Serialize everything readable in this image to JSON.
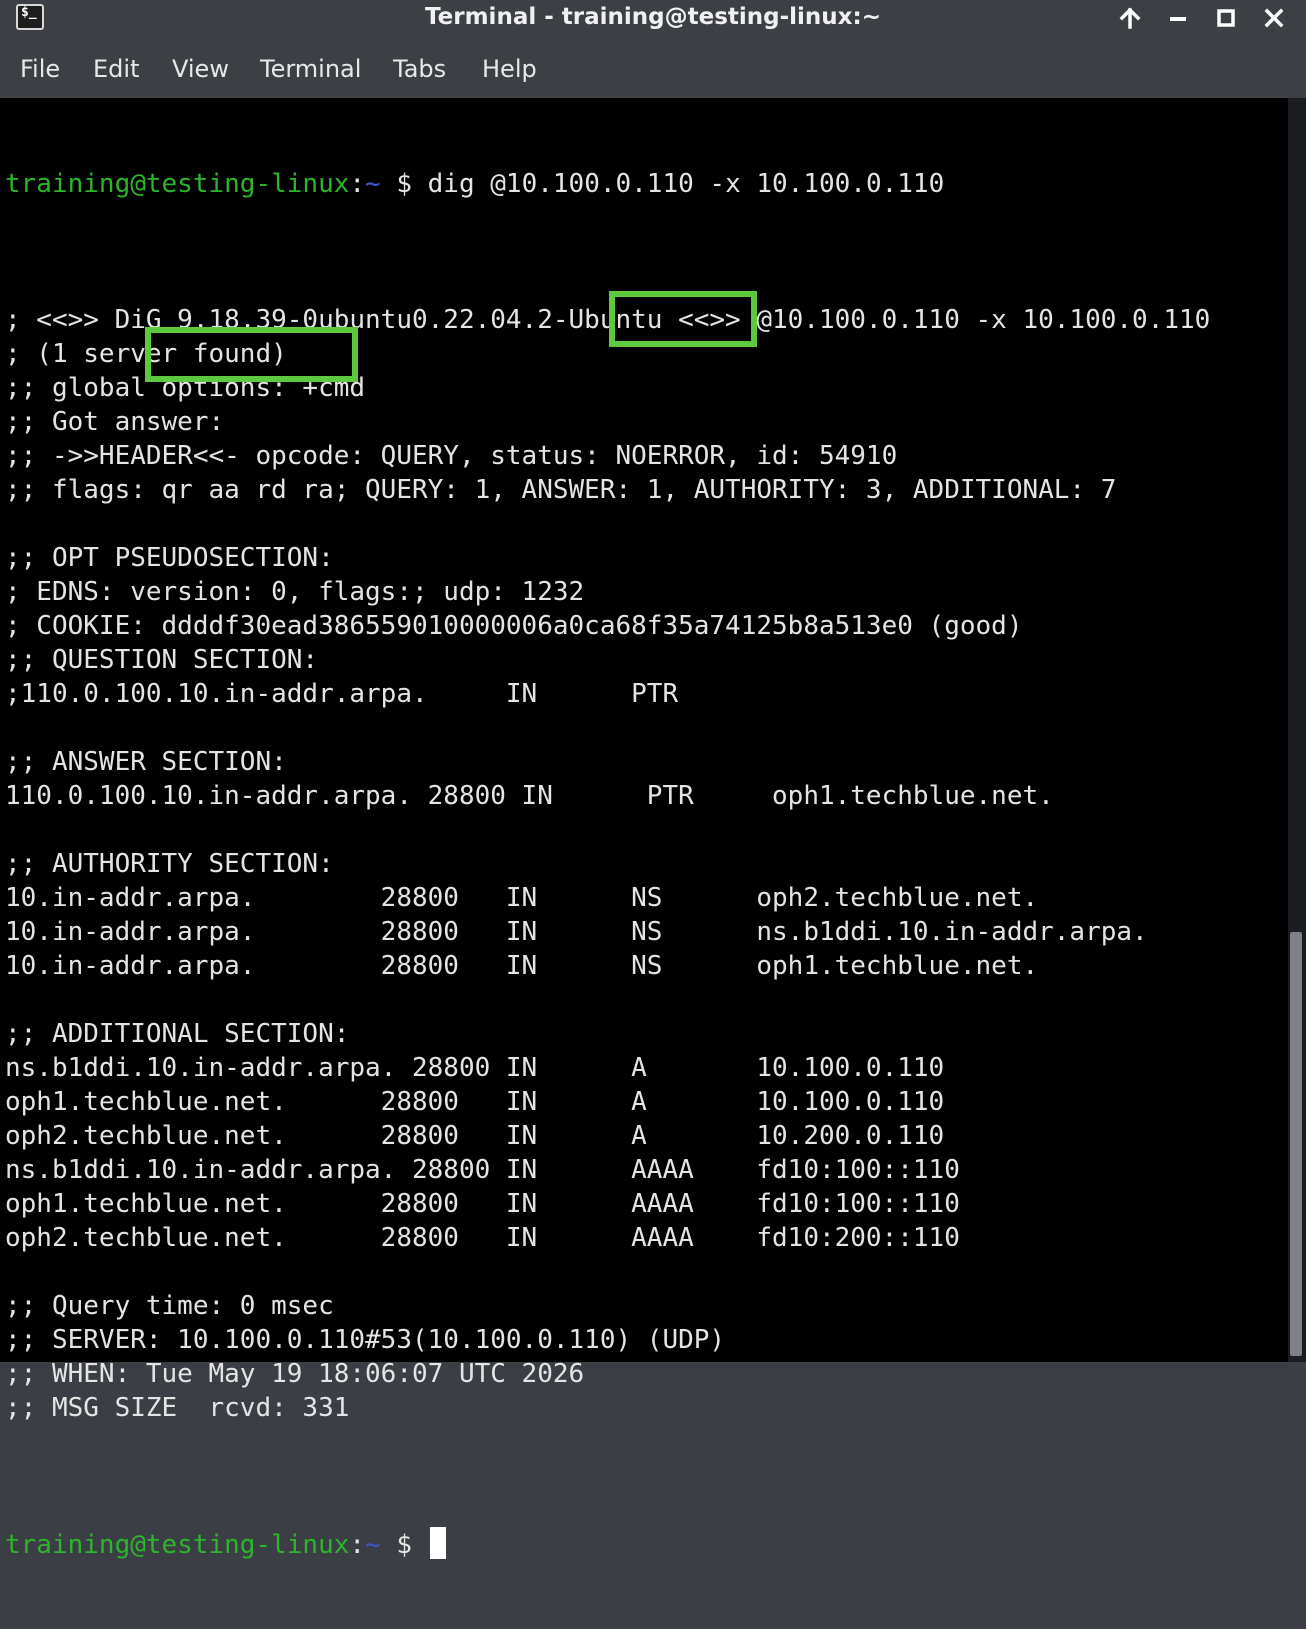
{
  "window": {
    "title": "Terminal - training@testing-linux:~"
  },
  "menubar": {
    "items": [
      "File",
      "Edit",
      "View",
      "Terminal",
      "Tabs",
      "Help"
    ]
  },
  "prompt": {
    "user_host": "training@testing-linux",
    "path_sep": ":",
    "path": "~",
    "symbol": " $ "
  },
  "terminal": {
    "command": "dig @10.100.0.110 -x 10.100.0.110",
    "output_lines": [
      "",
      "; <<>> DiG 9.18.39-0ubuntu0.22.04.2-Ubuntu <<>> @10.100.0.110 -x 10.100.0.110",
      "; (1 server found)",
      ";; global options: +cmd",
      ";; Got answer:",
      ";; ->>HEADER<<- opcode: QUERY, status: NOERROR, id: 54910",
      ";; flags: qr aa rd ra; QUERY: 1, ANSWER: 1, AUTHORITY: 3, ADDITIONAL: 7",
      "",
      ";; OPT PSEUDOSECTION:",
      "; EDNS: version: 0, flags:; udp: 1232",
      "; COOKIE: ddddf30ead386559010000006a0ca68f35a74125b8a513e0 (good)",
      ";; QUESTION SECTION:",
      ";110.0.100.10.in-addr.arpa.     IN      PTR",
      "",
      ";; ANSWER SECTION:",
      "110.0.100.10.in-addr.arpa. 28800 IN      PTR     oph1.techblue.net.",
      "",
      ";; AUTHORITY SECTION:",
      "10.in-addr.arpa.        28800   IN      NS      oph2.techblue.net.",
      "10.in-addr.arpa.        28800   IN      NS      ns.b1ddi.10.in-addr.arpa.",
      "10.in-addr.arpa.        28800   IN      NS      oph1.techblue.net.",
      "",
      ";; ADDITIONAL SECTION:",
      "ns.b1ddi.10.in-addr.arpa. 28800 IN      A       10.100.0.110",
      "oph1.techblue.net.      28800   IN      A       10.100.0.110",
      "oph2.techblue.net.      28800   IN      A       10.200.0.110",
      "ns.b1ddi.10.in-addr.arpa. 28800 IN      AAAA    fd10:100::110",
      "oph1.techblue.net.      28800   IN      AAAA    fd10:100::110",
      "oph2.techblue.net.      28800   IN      AAAA    fd10:200::110",
      "",
      ";; Query time: 0 msec",
      ";; SERVER: 10.100.0.110#53(10.100.0.110) (UDP)",
      ";; WHEN: Tue May 19 18:06:07 UTC 2026",
      ";; MSG SIZE  rcvd: 331",
      ""
    ]
  },
  "colors": {
    "terminal_bg": "#000000",
    "terminal_fg": "#e4e4e4",
    "prompt_user": "#2bb52b",
    "prompt_path": "#3f56c6",
    "highlight_box": "#5cc93f",
    "chrome_bg": "#3c4045"
  },
  "icons": {
    "app": "terminal-icon",
    "titlebar_buttons": [
      "keep-above-icon",
      "minimize-icon",
      "maximize-icon",
      "close-icon"
    ]
  }
}
